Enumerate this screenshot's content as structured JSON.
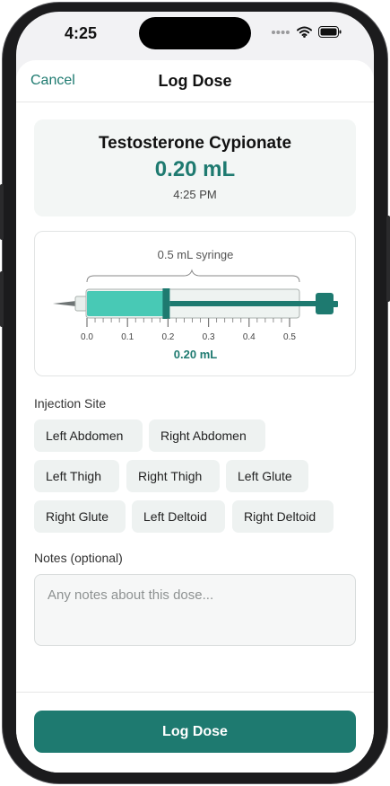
{
  "status_bar": {
    "time": "4:25"
  },
  "nav": {
    "cancel_label": "Cancel",
    "title": "Log Dose"
  },
  "summary": {
    "medication": "Testosterone Cypionate",
    "amount": "0.20 mL",
    "time": "4:25 PM"
  },
  "syringe": {
    "label": "0.5 mL syringe",
    "ticks": [
      "0.0",
      "0.1",
      "0.2",
      "0.3",
      "0.4",
      "0.5"
    ],
    "fill_value": 0.2,
    "max_value": 0.5,
    "fill_label": "0.20 mL",
    "colors": {
      "accent": "#1e7a70",
      "fill": "#48c9b5",
      "barrel": "#eef3f1"
    }
  },
  "injection_site": {
    "label": "Injection Site",
    "options": [
      "Left Abdomen",
      "Right Abdomen",
      "Left Thigh",
      "Right Thigh",
      "Left Glute",
      "Right Glute",
      "Left Deltoid",
      "Right Deltoid"
    ]
  },
  "notes": {
    "label": "Notes (optional)",
    "placeholder": "Any notes about this dose..."
  },
  "footer": {
    "log_button_label": "Log Dose"
  },
  "colors": {
    "accent": "#1e7a70",
    "chip_bg": "#eef2f1",
    "card_bg": "#f3f6f5"
  }
}
